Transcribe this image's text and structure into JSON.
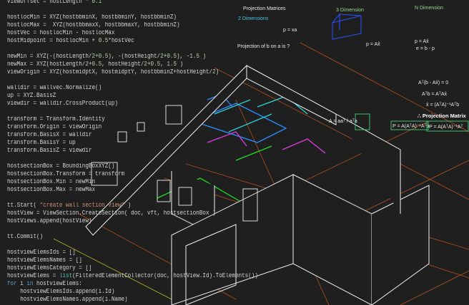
{
  "code_lines": [
    "viewOffset = hostLength * 0.1",
    "",
    "hostlocMin = XYZ(hostbbminX, hostbbminY, hostbbminZ)",
    "hostlocMax =  XYZ(hostbbmaxX, hostbbmaxY, hostbbminZ)",
    "hostVec = hostlocMin - hostlocMax",
    "hostMidpoint = hostlocMin + 0.5*hostVec",
    "",
    "newMin = XYZ(-(hostLength/2+0.5), -(hostHeight/2+0.5), -1.5 )",
    "newMax = XYZ(hostLength/2+0.5, hostHeight/2+0.5, 1.5 )",
    "viewOrigin = XYZ(hostmidptX, hostmidptY, hostbbminZ+hostHeight/2)",
    "",
    "walldir = wallvec.Normalize()",
    "up = XYZ.BasisZ",
    "viewdir = walldir.CrossProduct(up)",
    "",
    "transform = Transform.Identity",
    "transform.Origin = viewOrigin",
    "transform.BasisX = walldir",
    "transform.BasisY = up",
    "transform.BasisZ = viewdir",
    "",
    "hostsectionBox = BoundingBoxXYZ()",
    "hostsectionBox.Transform = transform",
    "hostsectionBox.Min = newMin",
    "hostsectionBox.Max = newMax",
    "",
    "tt.Start( \"create wall section view\" )",
    "hostView = ViewSection.CreateSection( doc, vft, hostsectionBox )",
    "hostViews.append(hostView)",
    "",
    "tt.Commit()",
    "",
    "hostviewElemsIds = []",
    "hostviewElemsNames = []",
    "hostviewElemsCategory = []",
    "hostviewElems = list(FilteredElementCollector(doc, hostView.Id).ToElements())",
    "for i in hostviewElems:",
    "    hostviewElemsIds.append(i.Id)",
    "    hostviewElemsNames.append(i.Name)"
  ],
  "board": {
    "title": "Projection Matrices",
    "two_dim": "2 Dimensions",
    "three_dim": "3 Dimension",
    "n_dim": "N Dimension",
    "p_xa": "p = xa",
    "question": "Projection of b on a is ?",
    "p_ax": "p = Ax̂",
    "p_ax_n": "p = Ax̂",
    "e_bp": "e = b - p",
    "at_eq": "Aᵀ(b - Ax̂) = 0",
    "atb": "Aᵀb = AᵀAx̂",
    "xhat": "x̂ = (AᵀA)⁻¹Aᵀb",
    "proj_matrix_label": "∴ Projection Matrix",
    "proj_2d": "A = aaᵀ / aᵀa",
    "proj_3d": "P = A(AᵀA)⁻¹Aᵀb",
    "proj_n": "P = A(AᵀA)⁻¹Aᵀ"
  },
  "colors": {
    "background": "#1f1f1f",
    "code_text": "#d4d4d4",
    "number": "#b5cea8",
    "keyword": "#569cd6"
  }
}
